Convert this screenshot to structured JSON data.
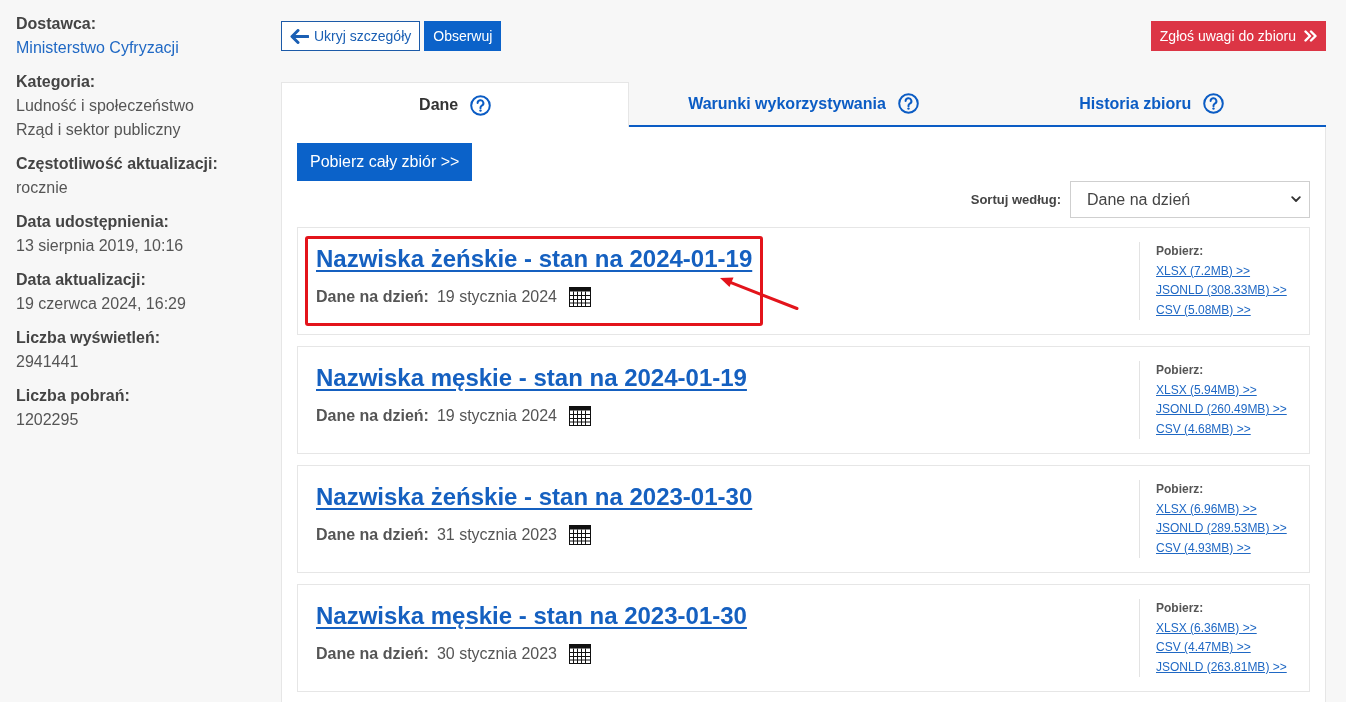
{
  "sidebar": {
    "items": [
      {
        "label": "Dostawca:",
        "kind": "link",
        "values": [
          "Ministerstwo Cyfryzacji"
        ]
      },
      {
        "label": "Kategoria:",
        "kind": "text",
        "values": [
          "Ludność i społeczeństwo",
          "Rząd i sektor publiczny"
        ]
      },
      {
        "label": "Częstotliwość aktualizacji:",
        "kind": "text",
        "values": [
          "rocznie"
        ]
      },
      {
        "label": "Data udostępnienia:",
        "kind": "text",
        "values": [
          "13 sierpnia 2019, 10:16"
        ]
      },
      {
        "label": "Data aktualizacji:",
        "kind": "text",
        "values": [
          "19 czerwca 2024, 16:29"
        ]
      },
      {
        "label": "Liczba wyświetleń:",
        "kind": "text",
        "values": [
          "2941441"
        ]
      },
      {
        "label": "Liczba pobrań:",
        "kind": "text",
        "values": [
          "1202295"
        ]
      }
    ]
  },
  "toolbar": {
    "hide_details_button": "Ukryj szczegóły",
    "follow_button": "Obserwuj",
    "report_button": "Zgłoś uwagi do zbioru"
  },
  "tabs": [
    {
      "label": "Dane",
      "selected": true
    },
    {
      "label": "Warunki wykorzystywania",
      "selected": false
    },
    {
      "label": "Historia zbioru",
      "selected": false
    }
  ],
  "download_all_button": "Pobierz cały zbiór >>",
  "sort": {
    "label": "Sortuj według:",
    "value": "Dane na dzień"
  },
  "datasets": [
    {
      "title": "Nazwiska żeńskie - stan na 2024-01-19",
      "date_label": "Dane na dzień:",
      "date": "19 stycznia 2024",
      "highlighted": true,
      "downloads_label": "Pobierz:",
      "downloads": [
        "XLSX (7.2MB) >>",
        "JSONLD (308.33MB) >>",
        "CSV (5.08MB) >>"
      ]
    },
    {
      "title": "Nazwiska męskie - stan na 2024-01-19",
      "date_label": "Dane na dzień:",
      "date": "19 stycznia 2024",
      "highlighted": false,
      "downloads_label": "Pobierz:",
      "downloads": [
        "XLSX (5.94MB) >>",
        "JSONLD (260.49MB) >>",
        "CSV (4.68MB) >>"
      ]
    },
    {
      "title": "Nazwiska żeńskie - stan na 2023-01-30",
      "date_label": "Dane na dzień:",
      "date": "31 stycznia 2023",
      "highlighted": false,
      "downloads_label": "Pobierz:",
      "downloads": [
        "XLSX (6.96MB) >>",
        "JSONLD (289.53MB) >>",
        "CSV (4.93MB) >>"
      ]
    },
    {
      "title": "Nazwiska męskie - stan na 2023-01-30",
      "date_label": "Dane na dzień:",
      "date": "30 stycznia 2023",
      "highlighted": false,
      "downloads_label": "Pobierz:",
      "downloads": [
        "XLSX (6.36MB) >>",
        "CSV (4.47MB) >>",
        "JSONLD (263.81MB) >>"
      ]
    }
  ]
}
